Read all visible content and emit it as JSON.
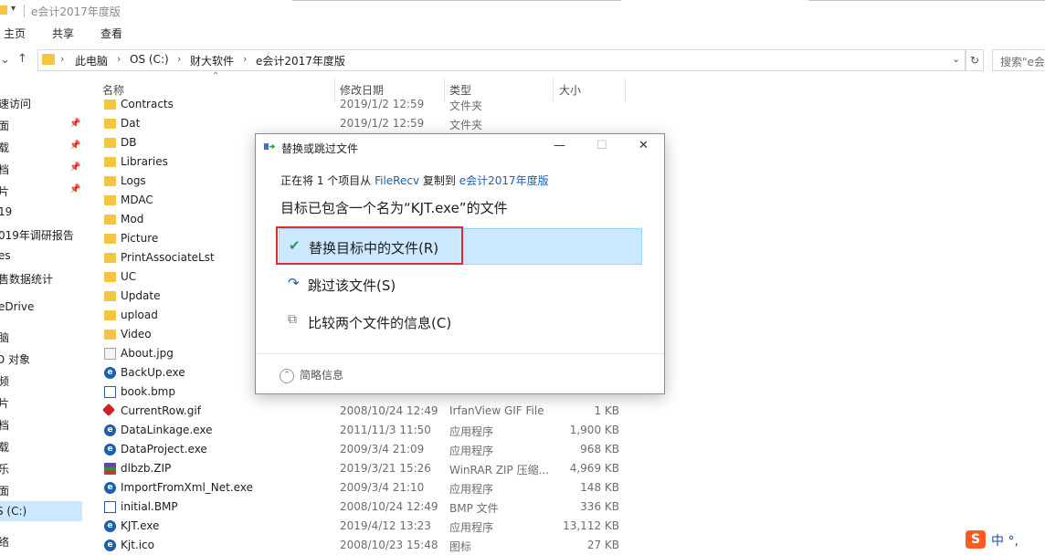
{
  "window": {
    "title": "e会计2017年度版"
  },
  "ribbon": {
    "tabs": [
      "主页",
      "共享",
      "查看"
    ]
  },
  "address": {
    "crumbs": [
      "此电脑",
      "OS (C:)",
      "财大软件",
      "e会计2017年度版"
    ],
    "search_placeholder": "搜索\"e会"
  },
  "nav_pane": {
    "items": [
      "速访问",
      "面",
      "载",
      "档",
      "片",
      "19",
      "019年调研报告",
      "es",
      "售数据统计",
      "eDrive",
      "脑",
      "D 对象",
      "频",
      "片",
      "档",
      "载",
      "乐",
      "面",
      "S (C:)",
      "络"
    ]
  },
  "columns": {
    "name": "名称",
    "modified": "修改日期",
    "type": "类型",
    "size": "大小"
  },
  "files": [
    {
      "name": "Contracts",
      "date": "2019/1/2 12:59",
      "type": "文件夹",
      "size": "",
      "icon": "folder-icon"
    },
    {
      "name": "Dat",
      "date": "2019/1/2 12:59",
      "type": "文件夹",
      "size": "",
      "icon": "folder-icon"
    },
    {
      "name": "DB",
      "date": "",
      "type": "",
      "size": "",
      "icon": "folder-icon"
    },
    {
      "name": "Libraries",
      "date": "",
      "type": "",
      "size": "",
      "icon": "folder-icon"
    },
    {
      "name": "Logs",
      "date": "",
      "type": "",
      "size": "",
      "icon": "folder-icon"
    },
    {
      "name": "MDAC",
      "date": "",
      "type": "",
      "size": "",
      "icon": "folder-icon"
    },
    {
      "name": "Mod",
      "date": "",
      "type": "",
      "size": "",
      "icon": "folder-icon"
    },
    {
      "name": "Picture",
      "date": "",
      "type": "",
      "size": "",
      "icon": "folder-icon"
    },
    {
      "name": "PrintAssociateLst",
      "date": "",
      "type": "",
      "size": "",
      "icon": "folder-icon"
    },
    {
      "name": "UC",
      "date": "",
      "type": "",
      "size": "",
      "icon": "folder-icon"
    },
    {
      "name": "Update",
      "date": "",
      "type": "",
      "size": "",
      "icon": "folder-icon"
    },
    {
      "name": "upload",
      "date": "",
      "type": "",
      "size": "",
      "icon": "folder-icon"
    },
    {
      "name": "Video",
      "date": "",
      "type": "",
      "size": "",
      "icon": "folder-icon"
    },
    {
      "name": "About.jpg",
      "date": "",
      "type": "",
      "size": "",
      "icon": "image-icon"
    },
    {
      "name": "BackUp.exe",
      "date": "",
      "type": "",
      "size": "",
      "icon": "exe-icon"
    },
    {
      "name": "book.bmp",
      "date": "",
      "type": "",
      "size": "",
      "icon": "bmp-icon"
    },
    {
      "name": "CurrentRow.gif",
      "date": "2008/10/24 12:49",
      "type": "IrfanView GIF File",
      "size": "1 KB",
      "icon": "gif-icon"
    },
    {
      "name": "DataLinkage.exe",
      "date": "2011/11/3 11:50",
      "type": "应用程序",
      "size": "1,900 KB",
      "icon": "exe-icon"
    },
    {
      "name": "DataProject.exe",
      "date": "2009/3/4 21:09",
      "type": "应用程序",
      "size": "968 KB",
      "icon": "exe-icon"
    },
    {
      "name": "dlbzb.ZIP",
      "date": "2019/3/21 15:26",
      "type": "WinRAR ZIP 压缩...",
      "size": "4,969 KB",
      "icon": "zip-icon"
    },
    {
      "name": "ImportFromXml_Net.exe",
      "date": "2009/3/4 21:10",
      "type": "应用程序",
      "size": "148 KB",
      "icon": "exe-icon"
    },
    {
      "name": "initial.BMP",
      "date": "2008/10/24 12:49",
      "type": "BMP 文件",
      "size": "336 KB",
      "icon": "bmp-icon"
    },
    {
      "name": "KJT.exe",
      "date": "2019/4/12 13:23",
      "type": "应用程序",
      "size": "13,112 KB",
      "icon": "exe-icon"
    },
    {
      "name": "Kjt.ico",
      "date": "2008/10/23 15:48",
      "type": "图标",
      "size": "27 KB",
      "icon": "exe-icon"
    }
  ],
  "dialog": {
    "title": "替换或跳过文件",
    "copy_prefix": "正在将 1 个项目从",
    "source": "FileRecv",
    "copy_mid": "复制到",
    "dest": "e会计2017年度版",
    "headline": "目标已包含一个名为“KJT.exe”的文件",
    "options": [
      {
        "label": "替换目标中的文件(R)",
        "icon": "checkmark-icon"
      },
      {
        "label": "跳过该文件(S)",
        "icon": "skip-arrow-icon"
      },
      {
        "label": "比较两个文件的信息(C)",
        "icon": "compare-icon"
      }
    ],
    "more_info": "简略信息"
  },
  "ime": {
    "text": "中 °,"
  }
}
